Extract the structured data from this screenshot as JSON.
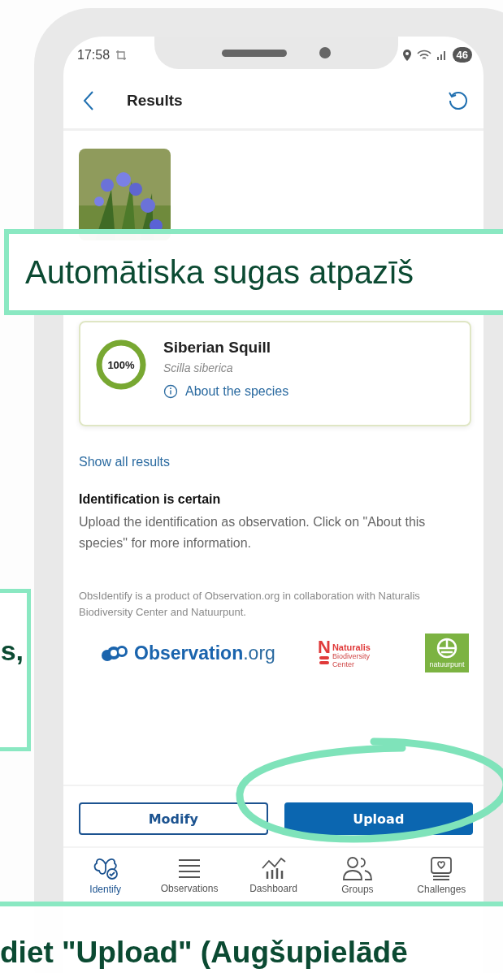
{
  "status_bar": {
    "time": "17:58",
    "battery": "46"
  },
  "header": {
    "title": "Results"
  },
  "result": {
    "confidence": "100%",
    "level": 1,
    "name": "Siberian Squill",
    "scientific_name": "Scilla siberica",
    "link": "About the species"
  },
  "show_all": "Show all results",
  "verdict": {
    "title": "Identification is certain",
    "text": "Upload the identification as observation. Click on \"About this species\" for more information."
  },
  "credit": "ObsIdentify is a product of Observation.org in collaboration with Naturalis Biodiversity Center and Natuurpunt.",
  "logos": {
    "observation": {
      "name": "Observation",
      "suffix": ".org"
    },
    "naturalis": {
      "mark": "N",
      "name": "Naturalis",
      "subtitle": "Biodiversity Center"
    },
    "natuurpunt": {
      "name": "natuurpunt"
    }
  },
  "buttons": [
    {
      "label": "Modify",
      "kind": "outline"
    },
    {
      "label": "Upload",
      "kind": "primary"
    }
  ],
  "nav": [
    {
      "label": "Identify",
      "selected": true
    },
    {
      "label": "Observations",
      "selected": false
    },
    {
      "label": "Dashboard",
      "selected": false
    },
    {
      "label": "Groups",
      "selected": false
    },
    {
      "label": "Challenges",
      "selected": false
    }
  ],
  "annotations": [
    {
      "kind": "box",
      "text": "Automātiska sugas atpazīš"
    },
    {
      "kind": "side",
      "text": "s,"
    },
    {
      "kind": "band",
      "text": "diet \"Upload\" (Augšupielādē"
    }
  ]
}
